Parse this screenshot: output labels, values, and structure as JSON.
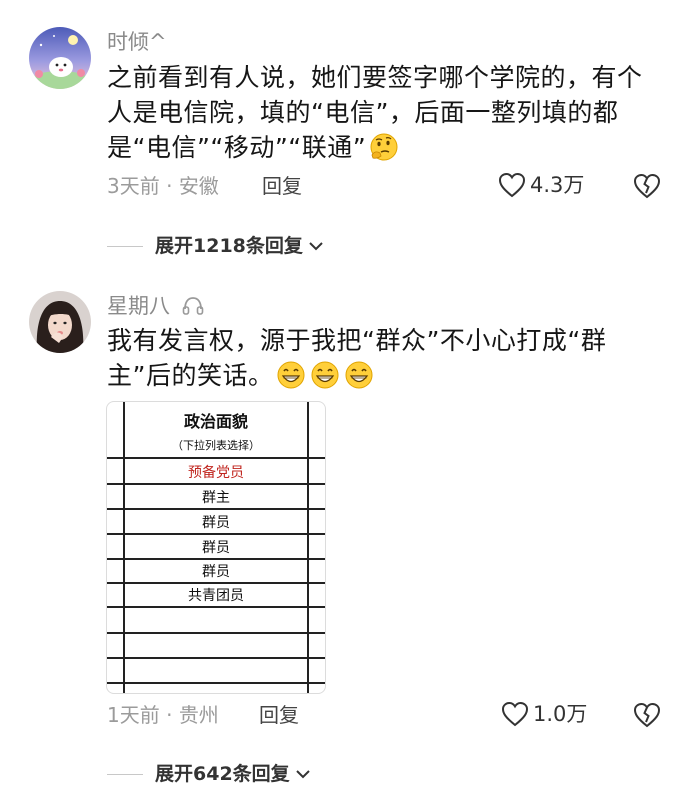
{
  "comments": [
    {
      "username": "时倾^",
      "text": "之前看到有人说，她们要签字哪个学院的，有个人是电信院，填的“电信”，后面一整列填的都是“电信”“移动”“联通”",
      "emoji": "thinking-face",
      "time": "3天前",
      "location": "安徽",
      "reply_label": "回复",
      "likes": "4.3万",
      "expand_label": "展开1218条回复"
    },
    {
      "username": "星期八",
      "username_badge": "headphones-icon",
      "text": "我有发言权，源于我把“群众”不小心打成“群主”后的笑话。",
      "emojis": [
        "grinning-face",
        "grinning-face",
        "grinning-face"
      ],
      "time": "1天前",
      "location": "贵州",
      "reply_label": "回复",
      "likes": "1.0万",
      "expand_label": "展开642条回复",
      "attachment": {
        "header": "政治面貌",
        "subheader": "（下拉列表选择）",
        "rows": [
          "预备党员",
          "群主",
          "群员",
          "群员",
          "群员",
          "共青团员"
        ],
        "highlight_color": "#c0261f"
      }
    }
  ],
  "colors": {
    "meta_gray": "#9b9b9b",
    "text": "#161616"
  }
}
